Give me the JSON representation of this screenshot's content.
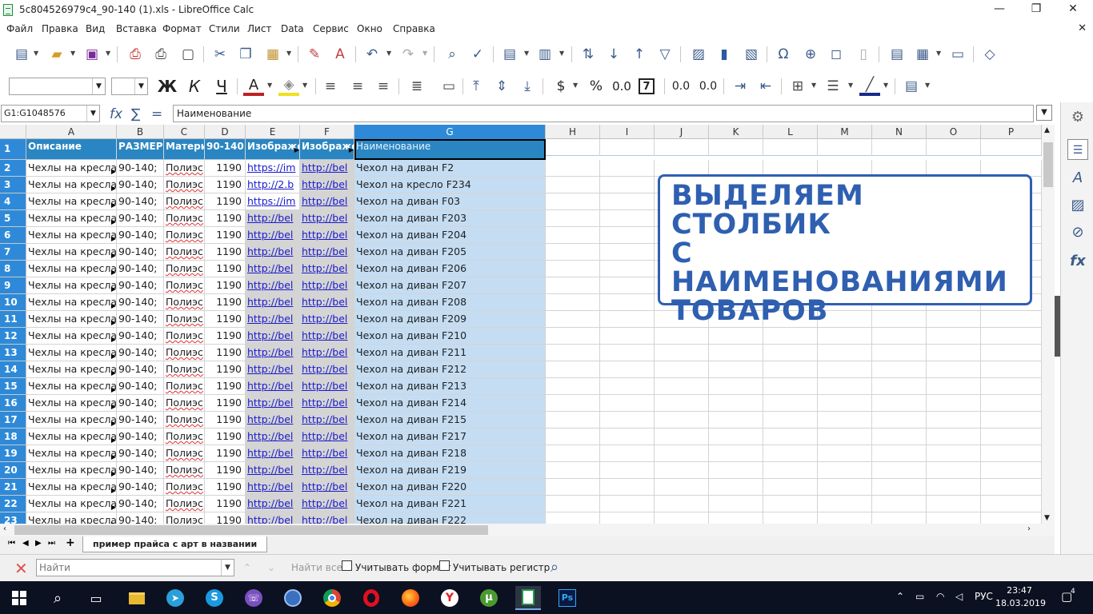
{
  "window": {
    "title": "5c804526979c4_90-140 (1).xls - LibreOffice Calc",
    "minimize": "—",
    "restore": "❐",
    "close": "✕"
  },
  "menu": [
    "Файл",
    "Правка",
    "Вид",
    "Вставка",
    "Формат",
    "Стили",
    "Лист",
    "Data",
    "Сервис",
    "Окно",
    "Справка"
  ],
  "menu_close": "✕",
  "format_toolbar": {
    "font_name": "",
    "font_size": "",
    "bold": "Ж",
    "italic": "К",
    "underline": "Ч",
    "font_color_letter": "A",
    "currency": "$",
    "percent": "%",
    "number": "0.0",
    "seven": "7",
    "add_decimal": "0.0",
    "del_decimal": "0.0"
  },
  "formula_bar": {
    "name_box": "G1:G1048576",
    "fx": "fx",
    "sigma": "∑",
    "equals": "=",
    "content": "Наименование"
  },
  "columns": [
    "A",
    "B",
    "C",
    "D",
    "E",
    "F",
    "G",
    "H",
    "I",
    "J",
    "K",
    "L",
    "M",
    "N",
    "O",
    "P"
  ],
  "header_row": {
    "num": "1",
    "A": "Описание",
    "B": "РАЗМЕР",
    "C": "Матери",
    "D": "90-140",
    "E": "Изображе",
    "F": "Изображе",
    "G": "Наименование"
  },
  "rows": [
    {
      "num": "2",
      "A": "Чехлы на кресла",
      "B": "90-140;",
      "C": "Полиэс",
      "D": "1190",
      "E": "https://im",
      "F": "http://bel",
      "G": "Чехол на диван F2"
    },
    {
      "num": "3",
      "A": "Чехлы на кресла",
      "B": "90-140;",
      "C": "Полиэс",
      "D": "1190",
      "E": "http://2.b",
      "F": "http://bel",
      "G": "Чехол на кресло F234"
    },
    {
      "num": "4",
      "A": "Чехлы на кресла",
      "B": "90-140;",
      "C": "Полиэс",
      "D": "1190",
      "E": "https://im",
      "F": "http://bel",
      "G": "Чехол на диван F03"
    },
    {
      "num": "5",
      "A": "Чехлы на кресла",
      "B": "90-140;",
      "C": "Полиэс",
      "D": "1190",
      "E": "http://bel",
      "F": "http://bel",
      "G": "Чехол на диван F203"
    },
    {
      "num": "6",
      "A": "Чехлы на кресла",
      "B": "90-140;",
      "C": "Полиэс",
      "D": "1190",
      "E": "http://bel",
      "F": "http://bel",
      "G": "Чехол на диван F204"
    },
    {
      "num": "7",
      "A": "Чехлы на кресла",
      "B": "90-140;",
      "C": "Полиэс",
      "D": "1190",
      "E": "http://bel",
      "F": "http://bel",
      "G": "Чехол на диван F205"
    },
    {
      "num": "8",
      "A": "Чехлы на кресла",
      "B": "90-140;",
      "C": "Полиэс",
      "D": "1190",
      "E": "http://bel",
      "F": "http://bel",
      "G": "Чехол на диван F206"
    },
    {
      "num": "9",
      "A": "Чехлы на кресла",
      "B": "90-140;",
      "C": "Полиэс",
      "D": "1190",
      "E": "http://bel",
      "F": "http://bel",
      "G": "Чехол на диван F207"
    },
    {
      "num": "10",
      "A": "Чехлы на кресла",
      "B": "90-140;",
      "C": "Полиэс",
      "D": "1190",
      "E": "http://bel",
      "F": "http://bel",
      "G": "Чехол на диван F208"
    },
    {
      "num": "11",
      "A": "Чехлы на кресла",
      "B": "90-140;",
      "C": "Полиэс",
      "D": "1190",
      "E": "http://bel",
      "F": "http://bel",
      "G": "Чехол на диван F209"
    },
    {
      "num": "12",
      "A": "Чехлы на кресла",
      "B": "90-140;",
      "C": "Полиэс",
      "D": "1190",
      "E": "http://bel",
      "F": "http://bel",
      "G": "Чехол на диван F210"
    },
    {
      "num": "13",
      "A": "Чехлы на кресла",
      "B": "90-140;",
      "C": "Полиэс",
      "D": "1190",
      "E": "http://bel",
      "F": "http://bel",
      "G": "Чехол на диван F211"
    },
    {
      "num": "14",
      "A": "Чехлы на кресла",
      "B": "90-140;",
      "C": "Полиэс",
      "D": "1190",
      "E": "http://bel",
      "F": "http://bel",
      "G": "Чехол на диван F212"
    },
    {
      "num": "15",
      "A": "Чехлы на кресла",
      "B": "90-140;",
      "C": "Полиэс",
      "D": "1190",
      "E": "http://bel",
      "F": "http://bel",
      "G": "Чехол на диван F213"
    },
    {
      "num": "16",
      "A": "Чехлы на кресла",
      "B": "90-140;",
      "C": "Полиэс",
      "D": "1190",
      "E": "http://bel",
      "F": "http://bel",
      "G": "Чехол на диван F214"
    },
    {
      "num": "17",
      "A": "Чехлы на кресла",
      "B": "90-140;",
      "C": "Полиэс",
      "D": "1190",
      "E": "http://bel",
      "F": "http://bel",
      "G": "Чехол на диван F215"
    },
    {
      "num": "18",
      "A": "Чехлы на кресла",
      "B": "90-140;",
      "C": "Полиэс",
      "D": "1190",
      "E": "http://bel",
      "F": "http://bel",
      "G": "Чехол на диван F217"
    },
    {
      "num": "19",
      "A": "Чехлы на кресла",
      "B": "90-140;",
      "C": "Полиэс",
      "D": "1190",
      "E": "http://bel",
      "F": "http://bel",
      "G": "Чехол на диван F218"
    },
    {
      "num": "20",
      "A": "Чехлы на кресла",
      "B": "90-140;",
      "C": "Полиэс",
      "D": "1190",
      "E": "http://bel",
      "F": "http://bel",
      "G": "Чехол на диван F219"
    },
    {
      "num": "21",
      "A": "Чехлы на кресла",
      "B": "90-140;",
      "C": "Полиэс",
      "D": "1190",
      "E": "http://bel",
      "F": "http://bel",
      "G": "Чехол на диван F220"
    },
    {
      "num": "22",
      "A": "Чехлы на кресла",
      "B": "90-140;",
      "C": "Полиэс",
      "D": "1190",
      "E": "http://bel",
      "F": "http://bel",
      "G": "Чехол на диван F221"
    },
    {
      "num": "23",
      "A": "Чехлы на кресла",
      "B": "90-140;",
      "C": "Полиэс",
      "D": "1190",
      "E": "http://bel",
      "F": "http://bel",
      "G": "Чехол на диван F222"
    }
  ],
  "callout": {
    "lines": [
      "ВЫДЕЛЯЕМ СТОЛБИК",
      "С НАИМЕНОВАНИЯМИ",
      "ТОВАРОВ"
    ],
    "color": "#2f5fb0"
  },
  "sheet_tabs": {
    "add": "+",
    "active": "пример прайса с арт в названии"
  },
  "find_bar": {
    "placeholder": "Найти",
    "find_all": "Найти все",
    "match_format": "Учитывать формат",
    "match_case": "Учитывать регистр"
  },
  "taskbar": {
    "lang": "РУС",
    "time": "23:47",
    "date": "18.03.2019",
    "notifications": "4"
  },
  "colors": {
    "selection_header": "#2e8ad8",
    "selected_cells": "#c4ddf3",
    "header_fill": "#2a86c2"
  }
}
